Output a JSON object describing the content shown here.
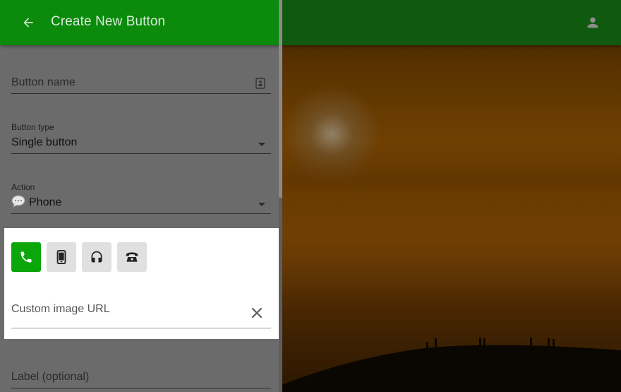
{
  "header": {
    "title": "Create New Button",
    "back_icon": "arrow-back-icon",
    "account_icon": "account-icon",
    "brand_color": "#0b8a0b"
  },
  "form": {
    "button_name": {
      "placeholder": "Button name",
      "icon": "contact-card-icon"
    },
    "button_type": {
      "label": "Button type",
      "value": "Single button"
    },
    "action": {
      "label": "Action",
      "value": "Phone",
      "icon": "chat-bubble-icon"
    },
    "icon_choices": [
      {
        "name": "phone-icon",
        "selected": true
      },
      {
        "name": "smartphone-icon",
        "selected": false
      },
      {
        "name": "headset-icon",
        "selected": false
      },
      {
        "name": "desk-phone-icon",
        "selected": false
      }
    ],
    "custom_image_url": {
      "placeholder": "Custom image URL",
      "icon": "close-icon"
    },
    "label": {
      "placeholder": "Label (optional)"
    }
  }
}
